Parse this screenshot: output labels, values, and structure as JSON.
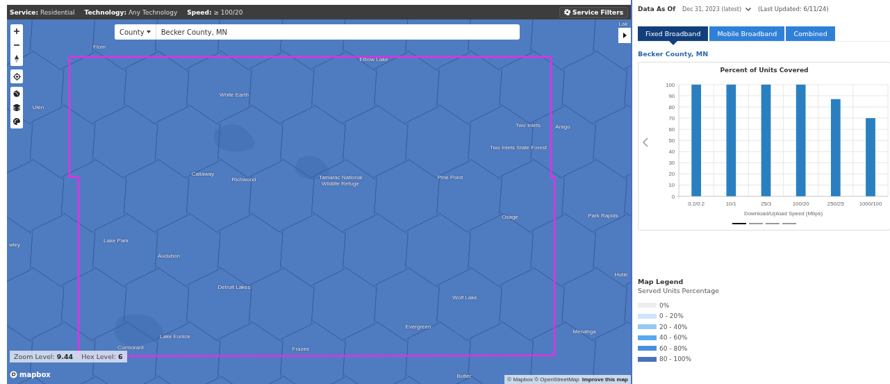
{
  "filter_bar": {
    "items": [
      "**Service:** Residential",
      "**Technology:** Any Technology",
      "**Speed:** ≥ 100/20"
    ],
    "button": "Service Filters"
  },
  "map": {
    "search": {
      "type_dropdown": "County",
      "value": "Becker County, MN"
    },
    "place_labels": [
      "Lak",
      "Flom",
      "Elbow Lake",
      "White Earth",
      "Ulen",
      "Two Inlets",
      "Arago",
      "Two Inlets State Forest",
      "Callaway",
      "Richwood",
      "Tamarac National Wildlife Refuge",
      "Pine Point",
      "Park Rapids",
      "Osage",
      "Lake Park",
      "wley",
      "Audubon",
      "Hubb",
      "Detroit Lakes",
      "Wolf Lake",
      "Evergreen",
      "Menahga",
      "Lake Eunice",
      "Cormorant",
      "Frazee",
      "Butler"
    ],
    "zoom_info": [
      "Zoom Level: **9.44**",
      "Hex Level: **6**"
    ],
    "logo": "mapbox",
    "attribution": "© Mapbox © OpenStreetMap",
    "improve_link": "Improve this map"
  },
  "panel": {
    "data_as_of": {
      "label": "Data As Of",
      "value": "Dec 31, 2023 (latest)",
      "last_updated": "(Last Updated: 6/11/24)"
    },
    "tabs": [
      {
        "label": "Fixed Broadband",
        "selected": true
      },
      {
        "label": "Mobile Broadband",
        "selected": false
      },
      {
        "label": "Combined",
        "selected": false
      }
    ],
    "area_title": "Becker County, MN",
    "chart": {
      "chart_data": {
        "type": "bar",
        "title": "Percent of Units Covered",
        "xlabel": "Download/Upload Speed (Mbps)",
        "categories": [
          "0.2/0.2",
          "10/1",
          "25/3",
          "100/20",
          "250/25",
          "1000/100"
        ],
        "grid": true,
        "series": [
          {
            "color": "#2a7fc0",
            "values": [
              100,
              100,
              100,
              100,
              87,
              70
            ]
          }
        ],
        "ylim": [
          0,
          100
        ],
        "yticks": [
          0,
          10,
          20,
          30,
          40,
          50,
          60,
          70,
          80,
          90,
          100
        ]
      },
      "pager": [
        {
          "selected": true
        },
        {
          "selected": false
        },
        {
          "selected": false
        },
        {
          "selected": false
        }
      ]
    },
    "legend": {
      "title": "Map Legend",
      "subtitle": "Served Units Percentage",
      "items": [
        {
          "label": "0%",
          "color": "#eeeeee"
        },
        {
          "label": "0 - 20%",
          "color": "#cfe5fb"
        },
        {
          "label": "20 - 40%",
          "color": "#95c8f4"
        },
        {
          "label": "40 - 60%",
          "color": "#5aa9ee"
        },
        {
          "label": "60 - 80%",
          "color": "#4b8ee0"
        },
        {
          "label": "80 - 100%",
          "color": "#4a72bd"
        }
      ]
    }
  }
}
